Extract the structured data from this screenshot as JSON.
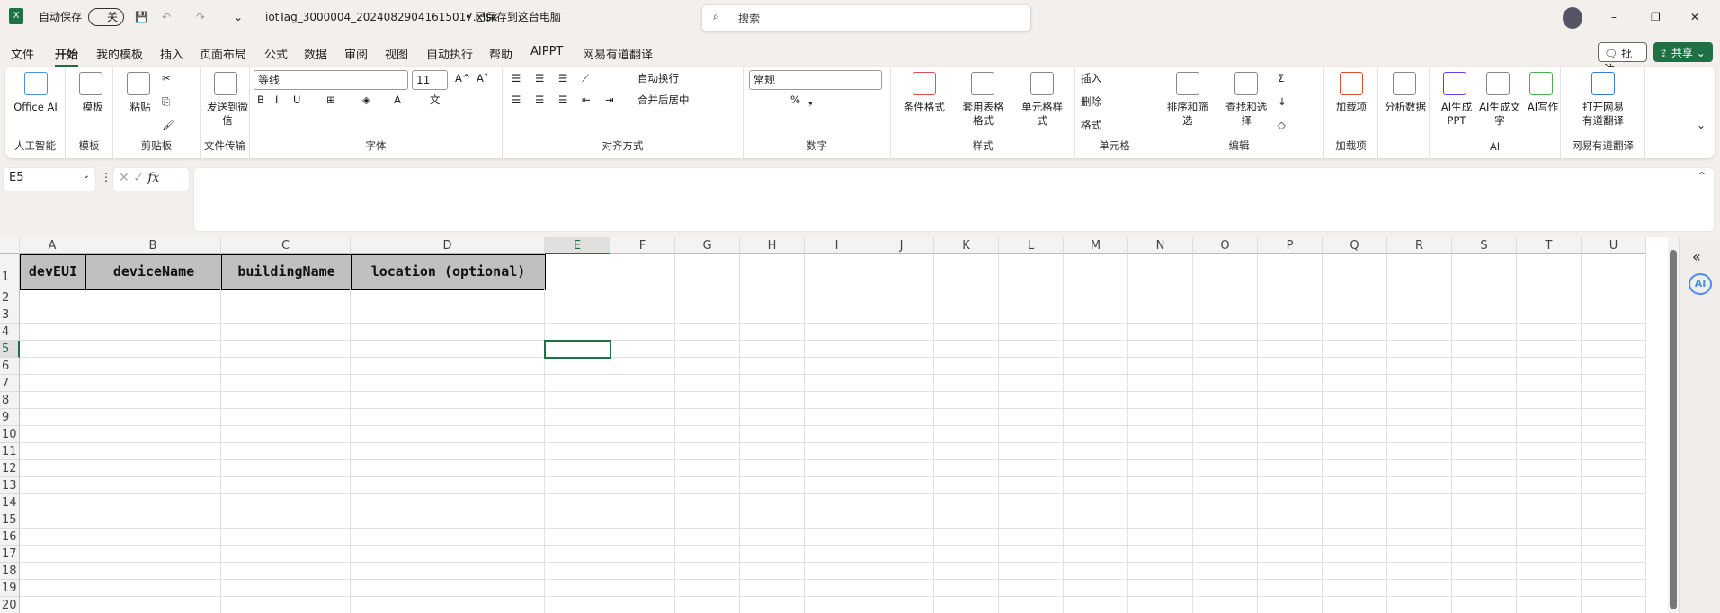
{
  "titlebar": {
    "autosave_label": "自动保存",
    "autosave_state": "关",
    "filename": "iotTag_3000004_20240829041615017.xlsx",
    "save_status": "• 已保存到这台电脑",
    "search_placeholder": "搜索",
    "minimize": "–",
    "restore": "❐",
    "close": "✕"
  },
  "tabs": [
    "文件",
    "开始",
    "我的模板",
    "插入",
    "页面布局",
    "公式",
    "数据",
    "审阅",
    "视图",
    "自动执行",
    "帮助",
    "AIPPT",
    "网易有道翻译"
  ],
  "active_tab": "开始",
  "comment_button": "批注",
  "share_button": "共享",
  "ribbon": {
    "font_name": "等线",
    "font_size": "11",
    "number_format": "常规",
    "groups": [
      {
        "label": "人工智能",
        "large": [
          {
            "label": "Office AI",
            "icon": "office-ai-icon"
          }
        ],
        "small": []
      },
      {
        "label": "模板",
        "large": [
          {
            "label": "模板",
            "icon": "template-icon"
          }
        ],
        "small": []
      },
      {
        "label": "剪贴板",
        "large": [
          {
            "label": "粘贴",
            "icon": "paste-icon"
          }
        ],
        "small": [
          {
            "label": "✂",
            "icon": "cut-icon"
          },
          {
            "label": "⎘",
            "icon": "copy-icon"
          },
          {
            "label": "🖌",
            "icon": "format-painter-icon"
          }
        ]
      },
      {
        "label": "文件传输",
        "large": [
          {
            "label": "发送到微信",
            "icon": "wechat-icon"
          }
        ],
        "small": []
      },
      {
        "label": "字体",
        "large": [],
        "small": [
          {
            "label": "A^",
            "icon": "increase-font-icon"
          },
          {
            "label": "Aˇ",
            "icon": "decrease-font-icon"
          },
          {
            "label": "B",
            "icon": "bold-icon"
          },
          {
            "label": "I",
            "icon": "italic-icon"
          },
          {
            "label": "U",
            "icon": "underline-icon"
          },
          {
            "label": "⊞",
            "icon": "border-icon"
          },
          {
            "label": "◈",
            "icon": "fill-color-icon"
          },
          {
            "label": "A",
            "icon": "font-color-icon"
          },
          {
            "label": "文",
            "icon": "phonetic-icon"
          }
        ]
      },
      {
        "label": "对齐方式",
        "large": [],
        "small": [
          {
            "label": "自动换行",
            "icon": "wrap-text-icon"
          },
          {
            "label": "合并后居中",
            "icon": "merge-center-icon"
          }
        ]
      },
      {
        "label": "数字",
        "large": [],
        "small": [
          {
            "label": "%",
            "icon": "percent-icon"
          },
          {
            "label": "❟",
            "icon": "comma-icon"
          }
        ]
      },
      {
        "label": "样式",
        "large": [
          {
            "label": "条件格式",
            "icon": "conditional-format-icon"
          },
          {
            "label": "套用表格格式",
            "icon": "table-format-icon"
          },
          {
            "label": "单元格样式",
            "icon": "cell-style-icon"
          }
        ],
        "small": []
      },
      {
        "label": "单元格",
        "large": [],
        "small": [
          {
            "label": "插入",
            "icon": "insert-cells-icon"
          },
          {
            "label": "删除",
            "icon": "delete-cells-icon"
          },
          {
            "label": "格式",
            "icon": "format-cells-icon"
          }
        ]
      },
      {
        "label": "编辑",
        "large": [
          {
            "label": "排序和筛选",
            "icon": "sort-filter-icon"
          },
          {
            "label": "查找和选择",
            "icon": "find-select-icon"
          }
        ],
        "small": [
          {
            "label": "Σ",
            "icon": "autosum-icon"
          },
          {
            "label": "↓",
            "icon": "fill-icon"
          },
          {
            "label": "◇",
            "icon": "clear-icon"
          }
        ]
      },
      {
        "label": "加载项",
        "large": [
          {
            "label": "加载项",
            "icon": "addins-icon"
          }
        ],
        "small": []
      },
      {
        "label": "",
        "large": [
          {
            "label": "分析数据",
            "icon": "analyze-data-icon"
          }
        ],
        "small": []
      },
      {
        "label": "AI",
        "large": [
          {
            "label": "AI生成PPT",
            "icon": "ai-ppt-icon"
          },
          {
            "label": "AI生成文字",
            "icon": "ai-text-avatar-icon"
          },
          {
            "label": "AI写作",
            "icon": "ai-write-icon"
          }
        ],
        "small": []
      },
      {
        "label": "网易有道翻译",
        "large": [
          {
            "label": "打开网易有道翻译",
            "icon": "youdao-translate-icon"
          }
        ],
        "small": []
      }
    ]
  },
  "formula_bar": {
    "name_box": "E5",
    "formula": ""
  },
  "sheet": {
    "columns": [
      "A",
      "B",
      "C",
      "D",
      "E",
      "F",
      "G",
      "H",
      "I",
      "J",
      "K",
      "L",
      "M",
      "N",
      "O",
      "P",
      "Q",
      "R",
      "S",
      "T",
      "U"
    ],
    "rows": 20,
    "header_row": [
      "devEUI",
      "deviceName",
      "buildingName",
      "location (optional)"
    ],
    "selected_cell": "E5",
    "header_fill": "#c0c0c0"
  },
  "colors": {
    "accent": "#1e7145"
  }
}
